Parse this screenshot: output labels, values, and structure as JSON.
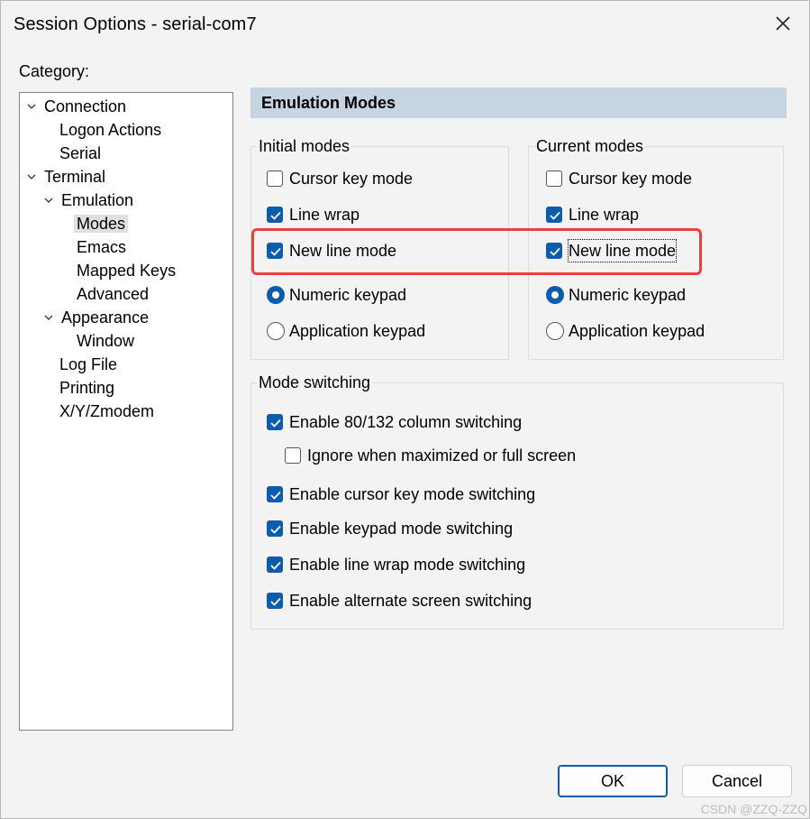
{
  "window": {
    "title": "Session Options - serial-com7"
  },
  "category": {
    "label": "Category:",
    "tree": [
      {
        "label": "Connection"
      },
      {
        "label": "Logon Actions"
      },
      {
        "label": "Serial"
      },
      {
        "label": "Terminal"
      },
      {
        "label": "Emulation"
      },
      {
        "label": "Modes"
      },
      {
        "label": "Emacs"
      },
      {
        "label": "Mapped Keys"
      },
      {
        "label": "Advanced"
      },
      {
        "label": "Appearance"
      },
      {
        "label": "Window"
      },
      {
        "label": "Log File"
      },
      {
        "label": "Printing"
      },
      {
        "label": "X/Y/Zmodem"
      }
    ]
  },
  "panel": {
    "header": "Emulation Modes",
    "initial": {
      "title": "Initial modes",
      "cursor_key": {
        "label": "Cursor key mode",
        "checked": false
      },
      "line_wrap": {
        "label": "Line wrap",
        "checked": true
      },
      "new_line": {
        "label": "New line mode",
        "checked": true
      },
      "numeric": {
        "label": "Numeric keypad",
        "selected": true
      },
      "application": {
        "label": "Application keypad",
        "selected": false
      }
    },
    "current": {
      "title": "Current modes",
      "cursor_key": {
        "label": "Cursor key mode",
        "checked": false
      },
      "line_wrap": {
        "label": "Line wrap",
        "checked": true
      },
      "new_line": {
        "label": "New line mode",
        "checked": true
      },
      "numeric": {
        "label": "Numeric keypad",
        "selected": true
      },
      "application": {
        "label": "Application keypad",
        "selected": false
      }
    },
    "switching": {
      "title": "Mode switching",
      "col_80_132": {
        "label": "Enable 80/132 column switching",
        "checked": true
      },
      "ignore_max": {
        "label": "Ignore when maximized or full screen",
        "checked": false
      },
      "cursor_key": {
        "label": "Enable cursor key mode switching",
        "checked": true
      },
      "keypad": {
        "label": "Enable keypad mode switching",
        "checked": true
      },
      "line_wrap": {
        "label": "Enable line wrap mode switching",
        "checked": true
      },
      "alt_screen": {
        "label": "Enable alternate screen switching",
        "checked": true
      }
    }
  },
  "buttons": {
    "ok": "OK",
    "cancel": "Cancel"
  },
  "watermark": "CSDN @ZZQ-ZZQ",
  "colors": {
    "accent": "#0b5cad",
    "header": "#c7d5e3",
    "highlight": "#e8413c"
  }
}
